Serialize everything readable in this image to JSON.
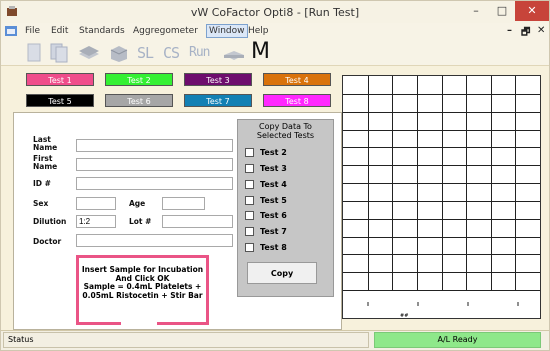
{
  "window": {
    "title": "vW CoFactor Opti8 - [Run Test]"
  },
  "window_controls": {
    "minimize": "–",
    "maximize": "□",
    "close": "✕"
  },
  "menu": {
    "items": [
      "File",
      "Edit",
      "Standards",
      "Aggregometer",
      "Window",
      "Help"
    ],
    "active": "Window",
    "mdi_controls": {
      "minimize": "–",
      "restore": "🗗",
      "close": "✕"
    }
  },
  "toolbar": {
    "sl_label": "SL",
    "cs_label": "CS",
    "run_label": "Run",
    "m_label": "M"
  },
  "tests": [
    {
      "label": "Test 1",
      "color": "#ef4d8b",
      "text_color": "#ffffff"
    },
    {
      "label": "Test 2",
      "color": "#35f033",
      "text_color": "#ffffff"
    },
    {
      "label": "Test 3",
      "color": "#6e0d6e",
      "text_color": "#ffffff"
    },
    {
      "label": "Test 4",
      "color": "#d9720b",
      "text_color": "#ffffff"
    },
    {
      "label": "Test 5",
      "color": "#000000",
      "text_color": "#ffffff"
    },
    {
      "label": "Test 6",
      "color": "#a6a6a6",
      "text_color": "#ffffff"
    },
    {
      "label": "Test 7",
      "color": "#1280b4",
      "text_color": "#ffffff"
    },
    {
      "label": "Test 8",
      "color": "#ff28ff",
      "text_color": "#ffffff"
    }
  ],
  "form": {
    "last_name_label": "Last\nName",
    "first_name_label": "First\nName",
    "id_label": "ID #",
    "sex_label": "Sex",
    "age_label": "Age",
    "dilution_label": "Dilution",
    "dilution_value": "1:2",
    "lot_label": "Lot #",
    "doctor_label": "Doctor"
  },
  "copy_panel": {
    "title": "Copy Data To\nSelected Tests",
    "options": [
      "Test 2",
      "Test 3",
      "Test 4",
      "Test 5",
      "Test 6",
      "Test 7",
      "Test 8"
    ],
    "button": "Copy"
  },
  "notice": "Insert Sample for Incubation\nAnd Click OK\nSample = 0.4mL Platelets +\n0.05mL Ristocetin + Stir Bar",
  "graph": {
    "x_mark": "##"
  },
  "status": {
    "left": "Status",
    "right": "A/L Ready",
    "right_color": "#8ee88a"
  }
}
